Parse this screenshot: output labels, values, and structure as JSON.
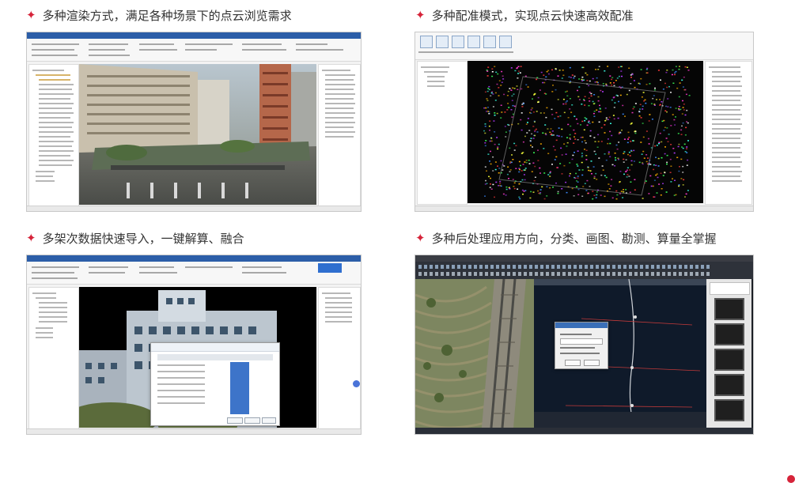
{
  "captions": [
    "多种渲染方式，满足各种场景下的点云浏览需求",
    "多种配准模式，实现点云快速高效配准",
    "多架次数据快速导入，一键解算、融合",
    "多种后处理应用方向，分类、画图、勘测、算量全掌握"
  ],
  "bullet_icon": "four-point-star",
  "colors": {
    "accent": "#d6243a",
    "text": "#333333",
    "app_titlebar": "#2c5ea8",
    "cad_background": "#0f1a2a"
  }
}
